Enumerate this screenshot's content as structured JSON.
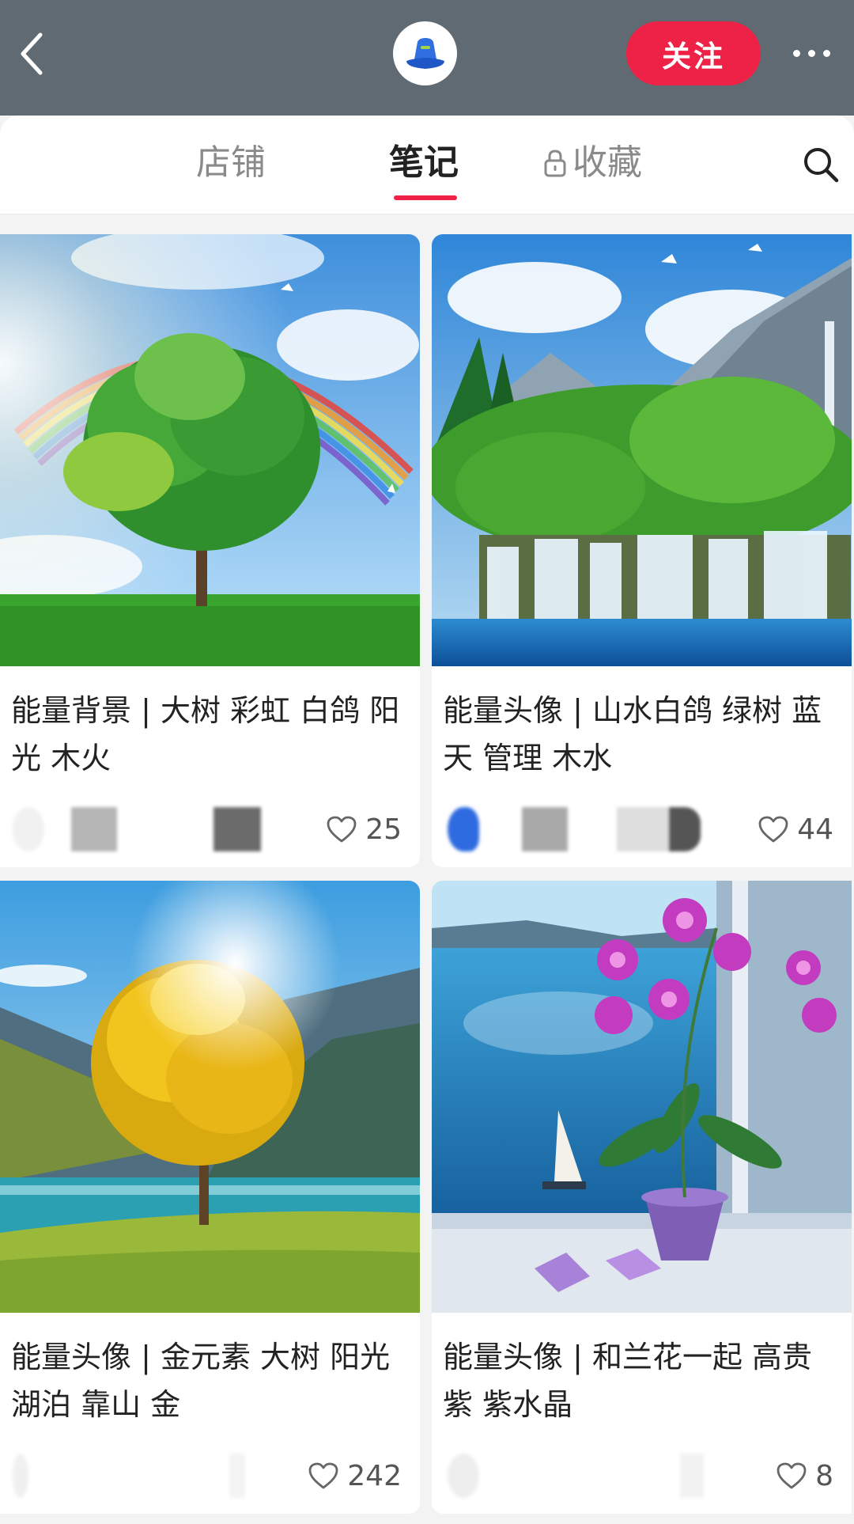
{
  "header": {
    "follow_label": "关注"
  },
  "tabs": {
    "store": "店铺",
    "notes": "笔记",
    "favorites": "收藏"
  },
  "notes": [
    {
      "title": "能量背景 | 大树 彩虹 白鸽 阳光 木火",
      "likes": "25"
    },
    {
      "title": "能量头像 | 山水白鸽 绿树 蓝天 管理 木水",
      "likes": "44"
    },
    {
      "title": "能量头像 | 金元素 大树 阳光 湖泊 靠山 金",
      "likes": "242"
    },
    {
      "title": "能量头像 | 和兰花一起 高贵紫 紫水晶",
      "likes": "8"
    }
  ],
  "colors": {
    "header_bg": "#5f6a73",
    "accent": "#ee2246"
  },
  "icons": [
    "back-arrow-icon",
    "blue-hat-avatar-icon",
    "more-dots-icon",
    "lock-icon",
    "search-icon",
    "heart-icon"
  ]
}
